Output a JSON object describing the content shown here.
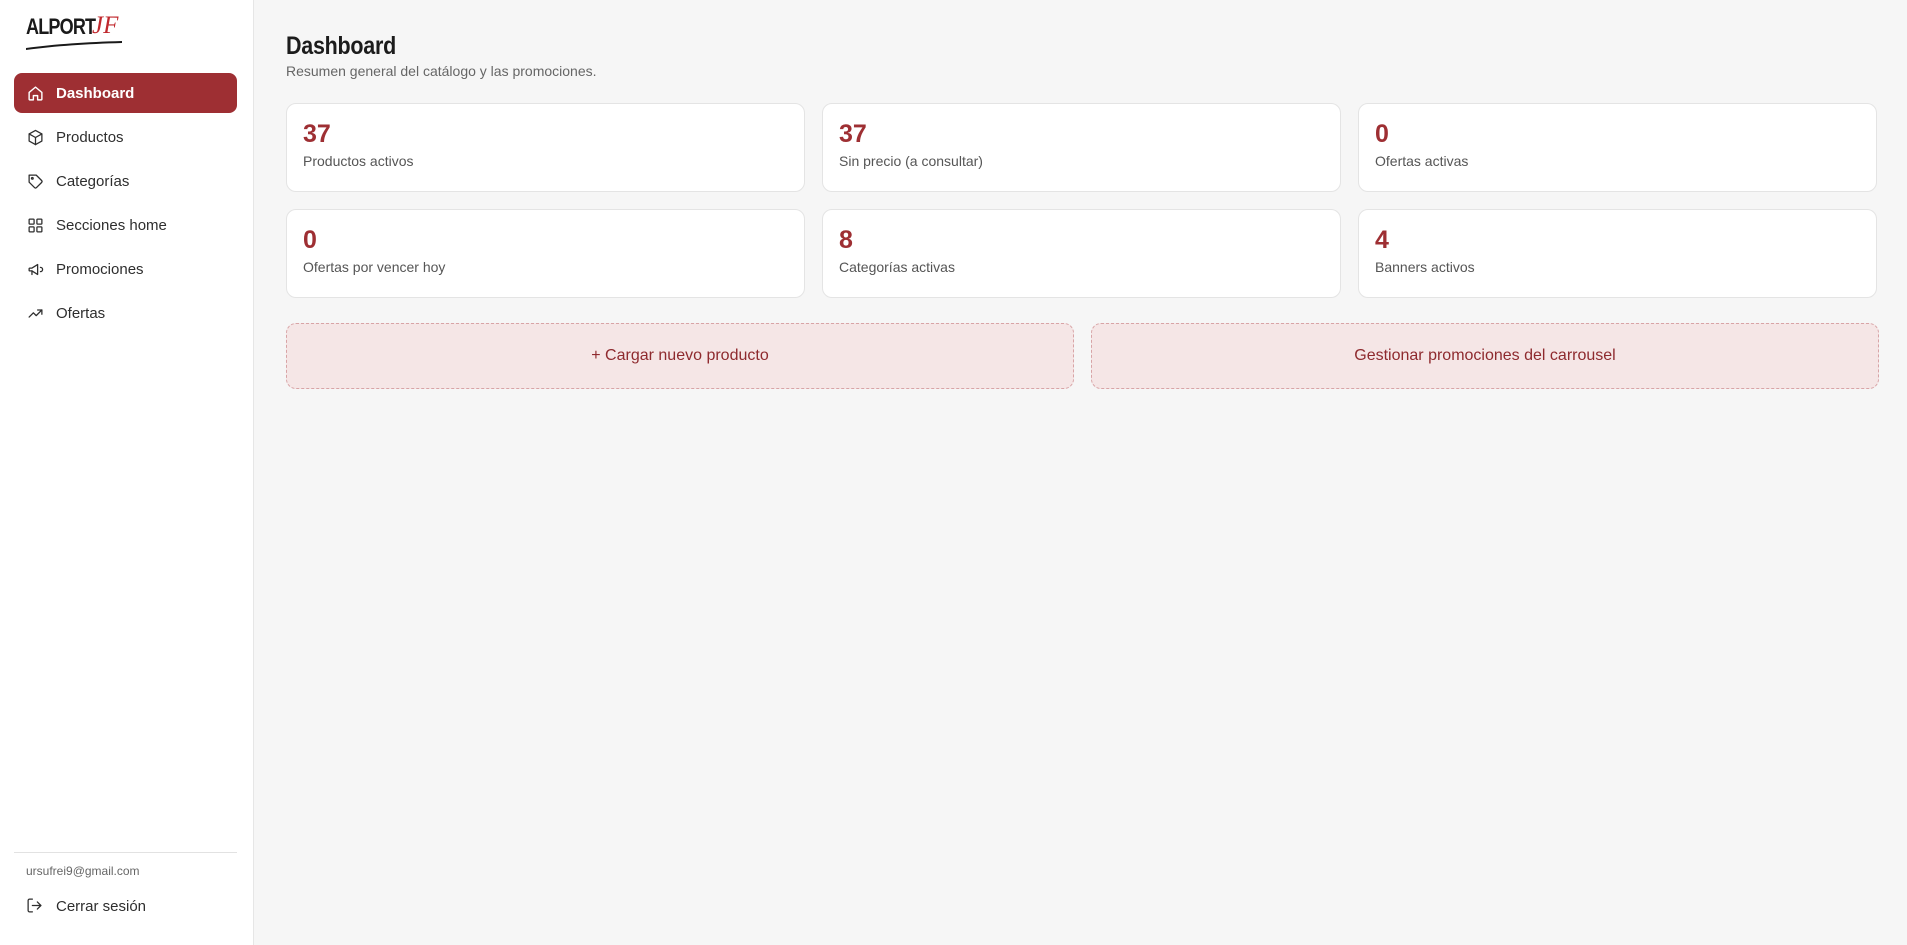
{
  "brand": {
    "logo_text": "ALPORT",
    "logo_accent": "JF"
  },
  "sidebar": {
    "items": [
      {
        "label": "Dashboard",
        "icon": "home-icon",
        "active": true
      },
      {
        "label": "Productos",
        "icon": "box-icon",
        "active": false
      },
      {
        "label": "Categorías",
        "icon": "tag-icon",
        "active": false
      },
      {
        "label": "Secciones home",
        "icon": "grid-icon",
        "active": false
      },
      {
        "label": "Promociones",
        "icon": "megaphone-icon",
        "active": false
      },
      {
        "label": "Ofertas",
        "icon": "trending-up-icon",
        "active": false
      }
    ],
    "user_email": "ursufrei9@gmail.com",
    "logout_label": "Cerrar sesión",
    "logout_icon": "logout-icon"
  },
  "header": {
    "title": "Dashboard",
    "subtitle": "Resumen general del catálogo y las promociones."
  },
  "stats": [
    {
      "value": "37",
      "label": "Productos activos"
    },
    {
      "value": "37",
      "label": "Sin precio (a consultar)"
    },
    {
      "value": "0",
      "label": "Ofertas activas"
    },
    {
      "value": "0",
      "label": "Ofertas por vencer hoy"
    },
    {
      "value": "8",
      "label": "Categorías activas"
    },
    {
      "value": "4",
      "label": "Banners activos"
    }
  ],
  "actions": {
    "new_product_label": "+ Cargar nuevo producto",
    "manage_promos_label": "Gestionar promociones del carrousel"
  },
  "colors": {
    "accent": "#9e2f33",
    "action_bg": "#f5e6e6",
    "background": "#f6f6f6"
  }
}
